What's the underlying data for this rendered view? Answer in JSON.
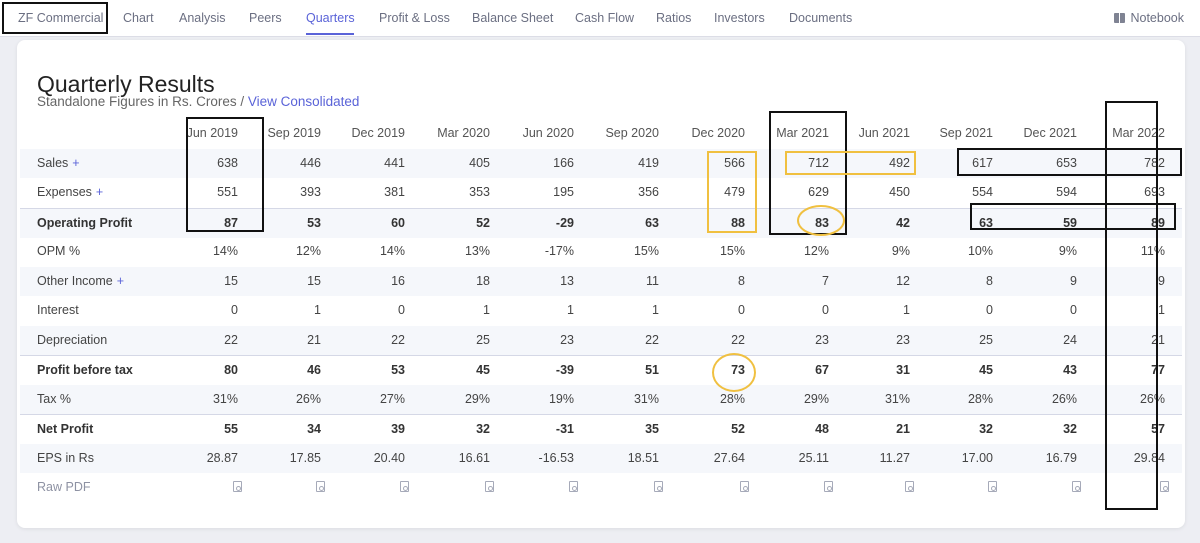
{
  "nav": {
    "tabs": [
      "ZF Commercial",
      "Chart",
      "Analysis",
      "Peers",
      "Quarters",
      "Profit & Loss",
      "Balance Sheet",
      "Cash Flow",
      "Ratios",
      "Investors",
      "Documents"
    ],
    "active_tab": "Quarters",
    "notebook_label": "Notebook"
  },
  "section": {
    "title": "Quarterly Results",
    "subtitle_prefix": "Standalone Figures in Rs. Crores / ",
    "consolidated_link": "View Consolidated"
  },
  "table": {
    "columns": [
      "Jun 2019",
      "Sep 2019",
      "Dec 2019",
      "Mar 2020",
      "Jun 2020",
      "Sep 2020",
      "Dec 2020",
      "Mar 2021",
      "Jun 2021",
      "Sep 2021",
      "Dec 2021",
      "Mar 2022"
    ],
    "rows": [
      {
        "label": "Sales",
        "expandable": true,
        "bold": false,
        "values": [
          "638",
          "446",
          "441",
          "405",
          "166",
          "419",
          "566",
          "712",
          "492",
          "617",
          "653",
          "782"
        ]
      },
      {
        "label": "Expenses",
        "expandable": true,
        "bold": false,
        "values": [
          "551",
          "393",
          "381",
          "353",
          "195",
          "356",
          "479",
          "629",
          "450",
          "554",
          "594",
          "693"
        ]
      },
      {
        "label": "Operating Profit",
        "expandable": false,
        "bold": true,
        "values": [
          "87",
          "53",
          "60",
          "52",
          "-29",
          "63",
          "88",
          "83",
          "42",
          "63",
          "59",
          "89"
        ]
      },
      {
        "label": "OPM %",
        "expandable": false,
        "bold": false,
        "values": [
          "14%",
          "12%",
          "14%",
          "13%",
          "-17%",
          "15%",
          "15%",
          "12%",
          "9%",
          "10%",
          "9%",
          "11%"
        ]
      },
      {
        "label": "Other Income",
        "expandable": true,
        "bold": false,
        "values": [
          "15",
          "15",
          "16",
          "18",
          "13",
          "11",
          "8",
          "7",
          "12",
          "8",
          "9",
          "9"
        ]
      },
      {
        "label": "Interest",
        "expandable": false,
        "bold": false,
        "values": [
          "0",
          "1",
          "0",
          "1",
          "1",
          "1",
          "0",
          "0",
          "1",
          "0",
          "0",
          "1"
        ]
      },
      {
        "label": "Depreciation",
        "expandable": false,
        "bold": false,
        "values": [
          "22",
          "21",
          "22",
          "25",
          "23",
          "22",
          "22",
          "23",
          "23",
          "25",
          "24",
          "21"
        ]
      },
      {
        "label": "Profit before tax",
        "expandable": false,
        "bold": true,
        "values": [
          "80",
          "46",
          "53",
          "45",
          "-39",
          "51",
          "73",
          "67",
          "31",
          "45",
          "43",
          "77"
        ]
      },
      {
        "label": "Tax %",
        "expandable": false,
        "bold": false,
        "values": [
          "31%",
          "26%",
          "27%",
          "29%",
          "19%",
          "31%",
          "28%",
          "29%",
          "31%",
          "28%",
          "26%",
          "26%"
        ]
      },
      {
        "label": "Net Profit",
        "expandable": false,
        "bold": true,
        "values": [
          "55",
          "34",
          "39",
          "32",
          "-31",
          "35",
          "52",
          "48",
          "21",
          "32",
          "32",
          "57"
        ]
      },
      {
        "label": "EPS in Rs",
        "expandable": false,
        "bold": false,
        "values": [
          "28.87",
          "17.85",
          "20.40",
          "16.61",
          "-16.53",
          "18.51",
          "27.64",
          "25.11",
          "11.27",
          "17.00",
          "16.79",
          "29.84"
        ]
      }
    ],
    "raw_pdf_label": "Raw PDF",
    "plus_symbol": "+"
  },
  "colors": {
    "accent": "#5a63d8",
    "annotation_black": "#111111",
    "annotation_yellow": "#f0c040"
  }
}
